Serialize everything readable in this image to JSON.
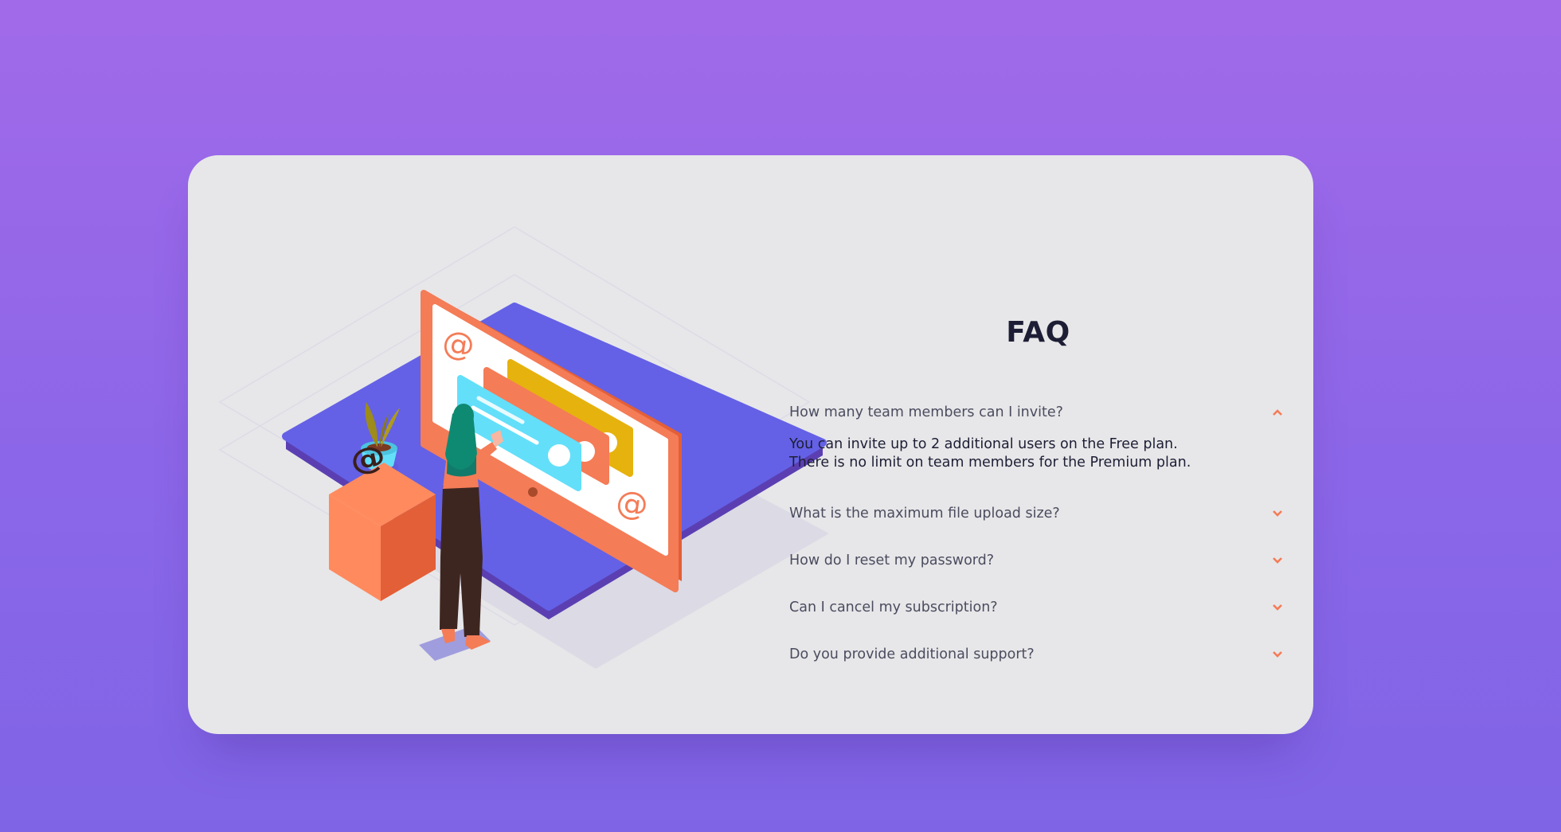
{
  "faq": {
    "title": "FAQ",
    "items": [
      {
        "question": "How many team members can I invite?",
        "expanded": true,
        "answer_lines": [
          "You can invite up to 2 additional users on the Free plan.",
          "There is no limit on team members for the Premium plan."
        ],
        "icon": "chevron-up-icon"
      },
      {
        "question": "What is the maximum file upload size?",
        "expanded": false,
        "icon": "chevron-down-icon"
      },
      {
        "question": "How do I reset my password?",
        "expanded": false,
        "icon": "chevron-down-icon"
      },
      {
        "question": "Can I cancel my subscription?",
        "expanded": false,
        "icon": "chevron-down-icon"
      },
      {
        "question": "Do you provide additional support?",
        "expanded": false,
        "icon": "chevron-down-icon"
      }
    ]
  },
  "colors": {
    "background_top": "#a16ae9",
    "background_bottom": "#7f65e6",
    "card": "#e7e7e9",
    "accent": "#f47c57",
    "heading": "#1d1e35",
    "text": "#4b4c5f"
  },
  "illustration": {
    "name": "woman-online-illustration",
    "symbol": "@"
  }
}
